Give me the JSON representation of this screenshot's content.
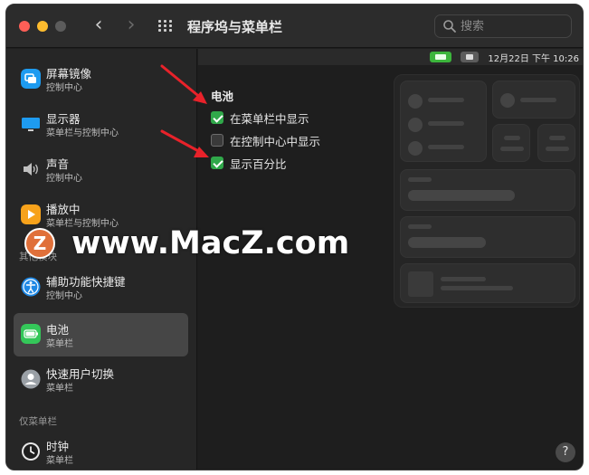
{
  "window": {
    "title": "程序坞与菜单栏"
  },
  "search": {
    "placeholder": "搜索"
  },
  "icons": {
    "back": "chevron-left-icon",
    "forward": "chevron-right-icon",
    "grid": "grid-icon",
    "search": "search-icon",
    "help": "question-icon"
  },
  "sidebar": {
    "items": [
      {
        "label": "屏幕镜像",
        "sub": "控制中心",
        "icon": "screen-mirroring-icon",
        "color": "#1e9bf0"
      },
      {
        "label": "显示器",
        "sub": "菜单栏与控制中心",
        "icon": "display-icon",
        "color": "#1e9bf0"
      },
      {
        "label": "声音",
        "sub": "控制中心",
        "icon": "sound-icon",
        "color": "#bfbfbf"
      },
      {
        "label": "播放中",
        "sub": "菜单栏与控制中心",
        "icon": "now-playing-icon",
        "color": "#f7a21b"
      },
      {
        "label": "辅助功能快捷键",
        "sub": "控制中心",
        "icon": "accessibility-icon",
        "color": "#1e88e5"
      },
      {
        "label": "电池",
        "sub": "菜单栏",
        "icon": "battery-icon",
        "color": "#34c759"
      },
      {
        "label": "快速用户切换",
        "sub": "菜单栏",
        "icon": "user-switch-icon",
        "color": "#9aa0a6"
      },
      {
        "label": "时钟",
        "sub": "菜单栏",
        "icon": "clock-icon",
        "color": "#e8e8e8"
      }
    ],
    "section_other": "其他模块",
    "section_menubar_only": "仅菜单栏"
  },
  "menubar_preview": {
    "clock": "12月22日 下午 10:26"
  },
  "battery": {
    "title": "电池",
    "options": [
      {
        "label": "在菜单栏中显示",
        "checked": true
      },
      {
        "label": "在控制中心中显示",
        "checked": false
      },
      {
        "label": "显示百分比",
        "checked": true
      }
    ]
  },
  "watermark": {
    "logo": "Z",
    "text": "www.MacZ.com"
  },
  "help": {
    "label": "?"
  },
  "colors": {
    "accent_check": "#30a84a",
    "arrow": "#e8222a"
  }
}
